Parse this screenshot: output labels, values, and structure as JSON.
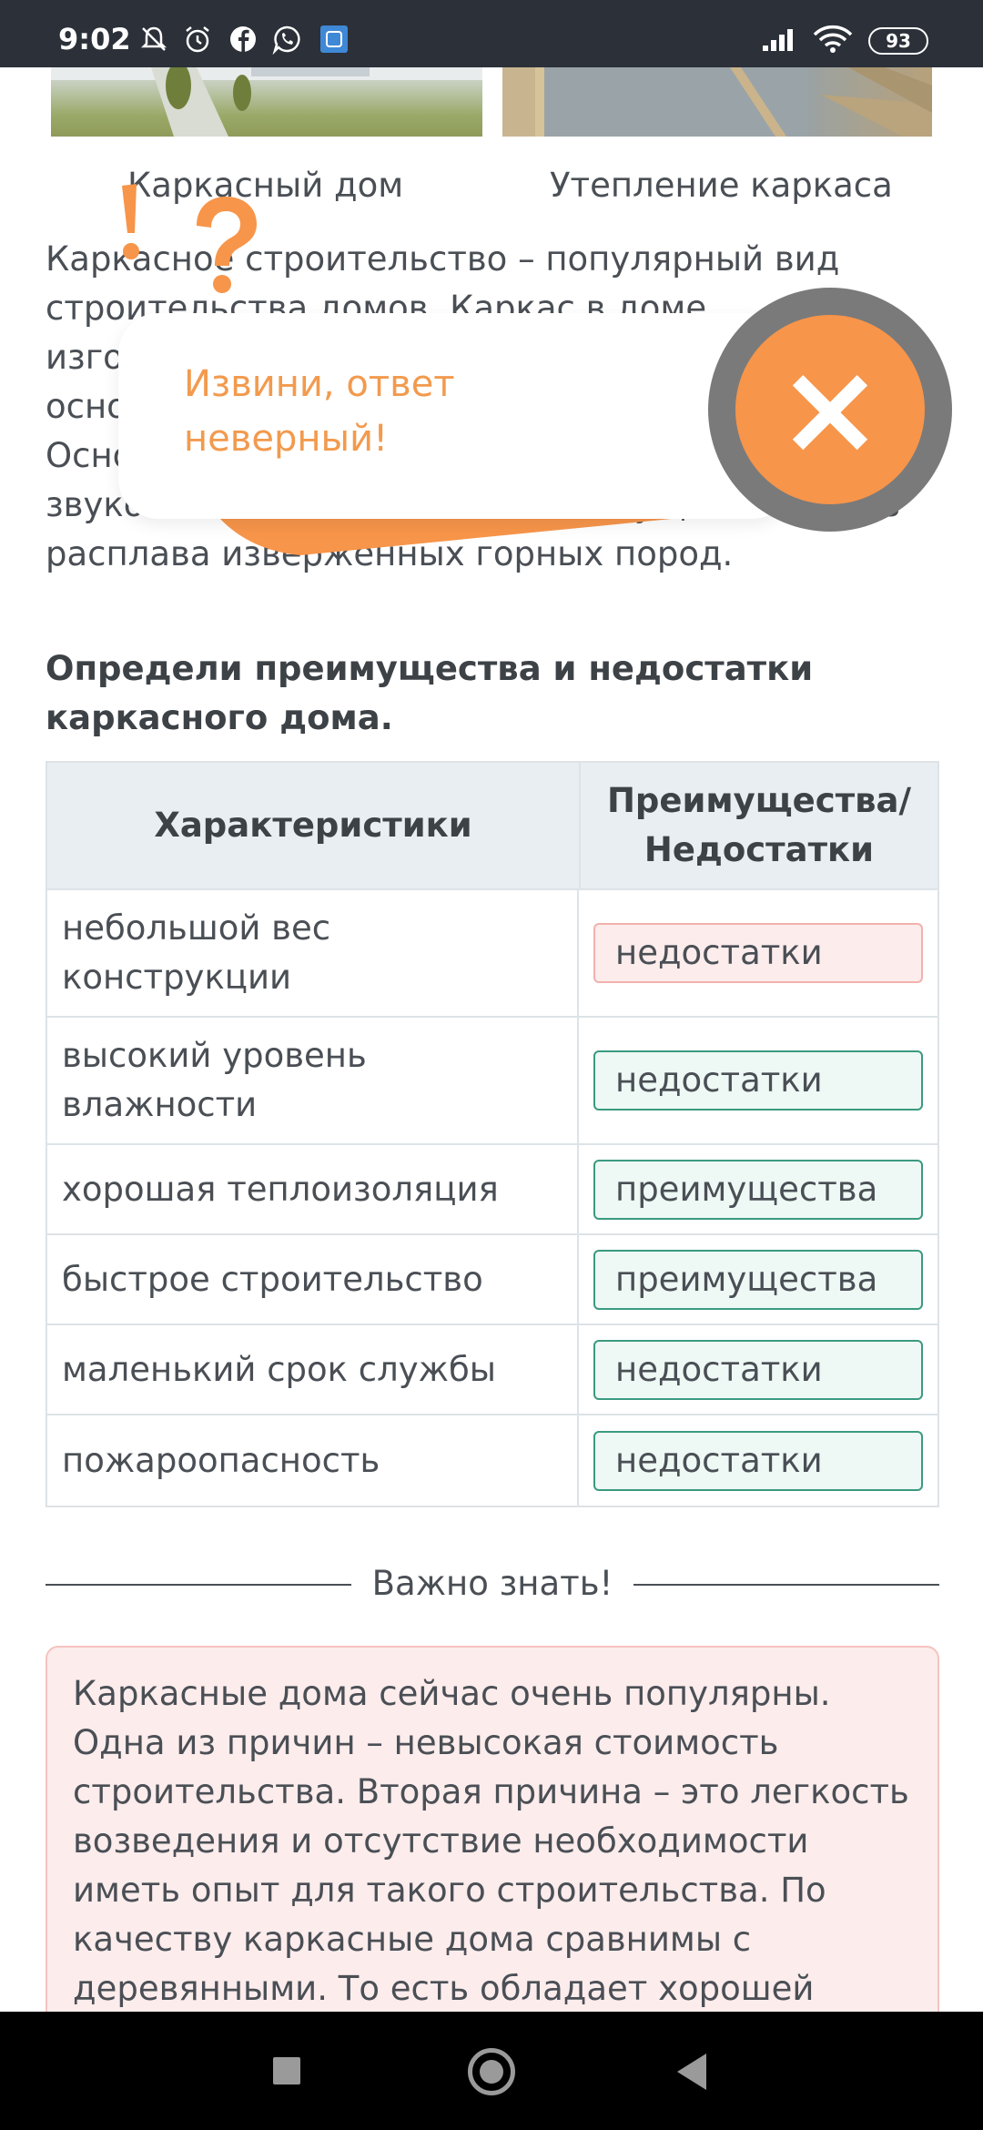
{
  "status_bar": {
    "time": "9:02",
    "icons": [
      "mute-bell-icon",
      "alarm-icon",
      "facebook-icon",
      "whatsapp-icon",
      "app-icon",
      "signal-icon",
      "wifi-icon"
    ],
    "battery": "93"
  },
  "images": [
    {
      "caption": "Каркасный дом"
    },
    {
      "caption": "Утепление каркаса"
    }
  ],
  "intro_text": "Каркасное строительство – популярный вид строительства домов. Каркас в доме изготавливается из дерева или металла, это основа, которую заполняют утеплителем. Основной материал для тепло- и звукоизоляции – минвата, преимущественно из расплава изверженных горных пород.",
  "question": "Определи преимущества и недостатки каркасного дома.",
  "table": {
    "headers": [
      "Характеристики",
      "Преимущества/ Недостатки"
    ],
    "rows": [
      {
        "characteristic": "небольшой вес конструкции",
        "answer": "недостатки",
        "status": "wrong"
      },
      {
        "characteristic": "высокий уровень влажности",
        "answer": "недостатки",
        "status": "correct"
      },
      {
        "characteristic": "хорошая теплоизоляция",
        "answer": "преимущества",
        "status": "correct"
      },
      {
        "characteristic": "быстрое строительство",
        "answer": "преимущества",
        "status": "correct"
      },
      {
        "characteristic": "маленький срок службы",
        "answer": "недостатки",
        "status": "correct"
      },
      {
        "characteristic": "пожароопасность",
        "answer": "недостатки",
        "status": "correct"
      }
    ]
  },
  "divider_label": "Важно знать!",
  "note_text": "Каркасные дома сейчас очень популярны. Одна из причин – невысокая стоимость строительства. Вторая причина – это легкость возведения и отсутствие необходимости иметь опыт для такого строительства. По качеству каркасные дома сравнимы с деревянными. То есть обладает хорошей теплоизоляцией, но",
  "popup": {
    "message": "Извини, ответ неверный!",
    "accent_color": "#f7954a",
    "close_icon": "close-icon"
  },
  "nav": {
    "icons": [
      "recent-apps-icon",
      "home-icon",
      "back-icon"
    ]
  }
}
